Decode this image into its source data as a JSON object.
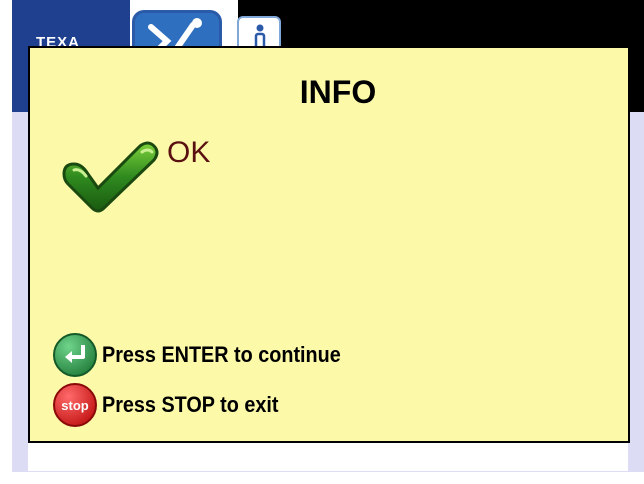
{
  "app": {
    "brand": "TEXA"
  },
  "dialog": {
    "title": "INFO",
    "status": "OK",
    "status_icon": "check-icon"
  },
  "hints": [
    {
      "icon": "enter-key-icon",
      "label": "Press ENTER to continue"
    },
    {
      "icon": "stop-icon",
      "label": "Press STOP to exit",
      "icon_text": "stop"
    }
  ],
  "colors": {
    "dialog_bg": "#fcfaa8",
    "app_content_bg": "#dcdcf4",
    "brand_blue": "#1f3f8f",
    "status_text": "#5a1010",
    "check_green": "#2f8a1f",
    "enter_green": "#2e9a4a",
    "stop_red": "#e02020"
  }
}
